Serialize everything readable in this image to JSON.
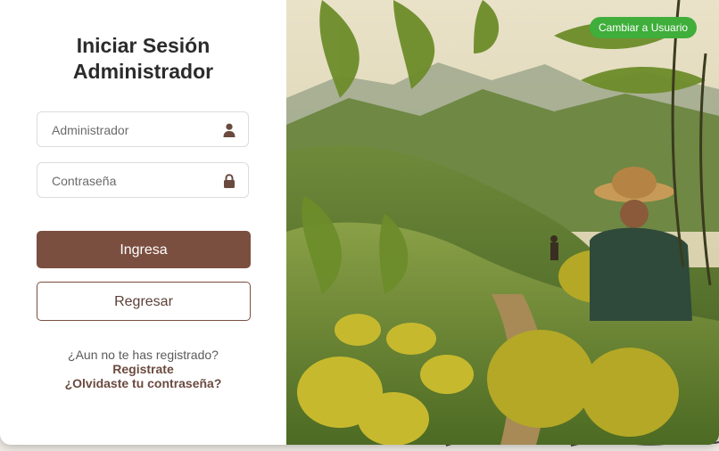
{
  "login": {
    "title_line1": "Iniciar Sesión",
    "title_line2": "Administrador",
    "username_placeholder": "Administrador",
    "password_placeholder": "Contraseña",
    "submit_label": "Ingresa",
    "back_label": "Regresar",
    "register_question": "¿Aun no te has registrado?",
    "register_link": "Registrate",
    "forgot_link": "¿Olvidaste tu contraseña?"
  },
  "header": {
    "switch_user_label": "Cambiar a Usuario"
  },
  "icons": {
    "username": "user-icon",
    "password": "lock-icon"
  },
  "colors": {
    "primary": "#7b4f40",
    "accent_green": "#3fae3b",
    "panel_bg": "#ffffff"
  }
}
